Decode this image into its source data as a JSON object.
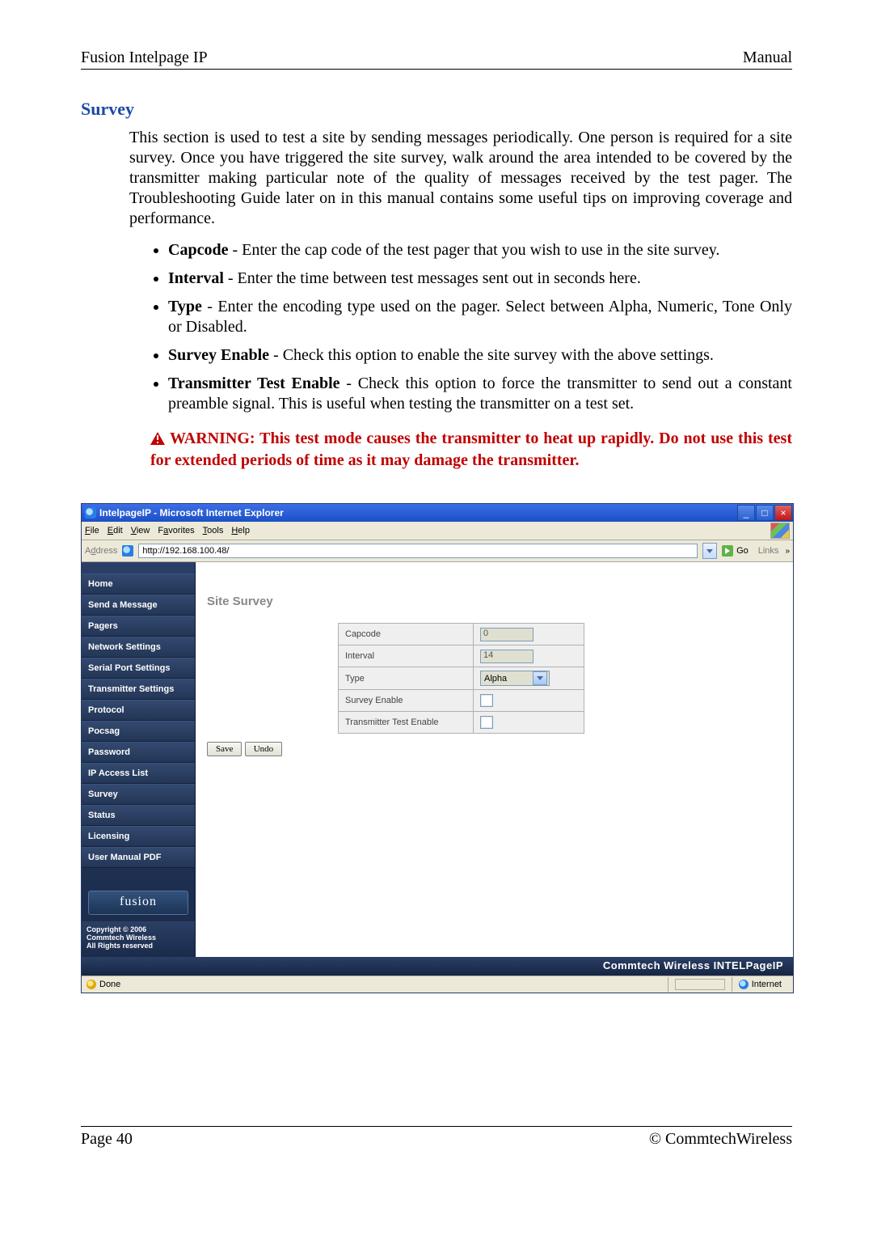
{
  "header": {
    "left": "Fusion Intelpage IP",
    "right": "Manual"
  },
  "section_title": "Survey",
  "intro": "This section is used to test a site by sending messages periodically. One person is required for a site survey. Once you have triggered the site survey, walk around the area intended to be covered by the transmitter making particular note of the quality of messages received by the test pager. The Troubleshooting Guide later on in this manual contains some useful tips on improving coverage and performance.",
  "bullets": [
    {
      "term": "Capcode",
      "desc": " - Enter the cap code of the test pager that you wish to use in the site survey."
    },
    {
      "term": "Interval",
      "desc": " - Enter the time between test messages sent out in seconds here."
    },
    {
      "term": "Type",
      "desc": " - Enter the encoding type used on the pager. Select between Alpha, Numeric, Tone Only or Disabled."
    },
    {
      "term": "Survey Enable",
      "desc": " - Check this option to enable the site survey with the above settings."
    },
    {
      "term": "Transmitter Test Enable",
      "desc": " - Check this option to force the transmitter to send out a constant preamble signal. This is useful when testing the transmitter on a test set."
    }
  ],
  "warning": "WARNING: This test mode causes the transmitter to heat up rapidly. Do not use this test for extended periods of time as it may damage the transmitter.",
  "browser": {
    "title": "IntelpageIP - Microsoft Internet Explorer",
    "menu": [
      "File",
      "Edit",
      "View",
      "Favorites",
      "Tools",
      "Help"
    ],
    "address_label": "Address",
    "url": "http://192.168.100.48/",
    "go": "Go",
    "links": "Links",
    "sidebar": [
      "Home",
      "Send a Message",
      "Pagers",
      "Network Settings",
      "Serial Port Settings",
      "Transmitter Settings",
      "Protocol",
      "Pocsag",
      "Password",
      "IP Access List",
      "Survey",
      "Status",
      "Licensing",
      "User Manual PDF"
    ],
    "logo": "fusion",
    "copyright": "Copyright © 2006\nCommtech Wireless\nAll Rights reserved",
    "main_heading": "Site Survey",
    "form": {
      "capcode_label": "Capcode",
      "capcode_value": "0",
      "interval_label": "Interval",
      "interval_value": "14",
      "type_label": "Type",
      "type_value": "Alpha",
      "survey_enable_label": "Survey Enable",
      "tx_test_label": "Transmitter Test Enable"
    },
    "save": "Save",
    "undo": "Undo",
    "footer_brand": "Commtech Wireless INTELPageIP",
    "status_done": "Done",
    "status_zone": "Internet"
  },
  "footer": {
    "page": "Page 40",
    "company_pre": "© Commtech",
    "company_suf": "Wireless"
  }
}
